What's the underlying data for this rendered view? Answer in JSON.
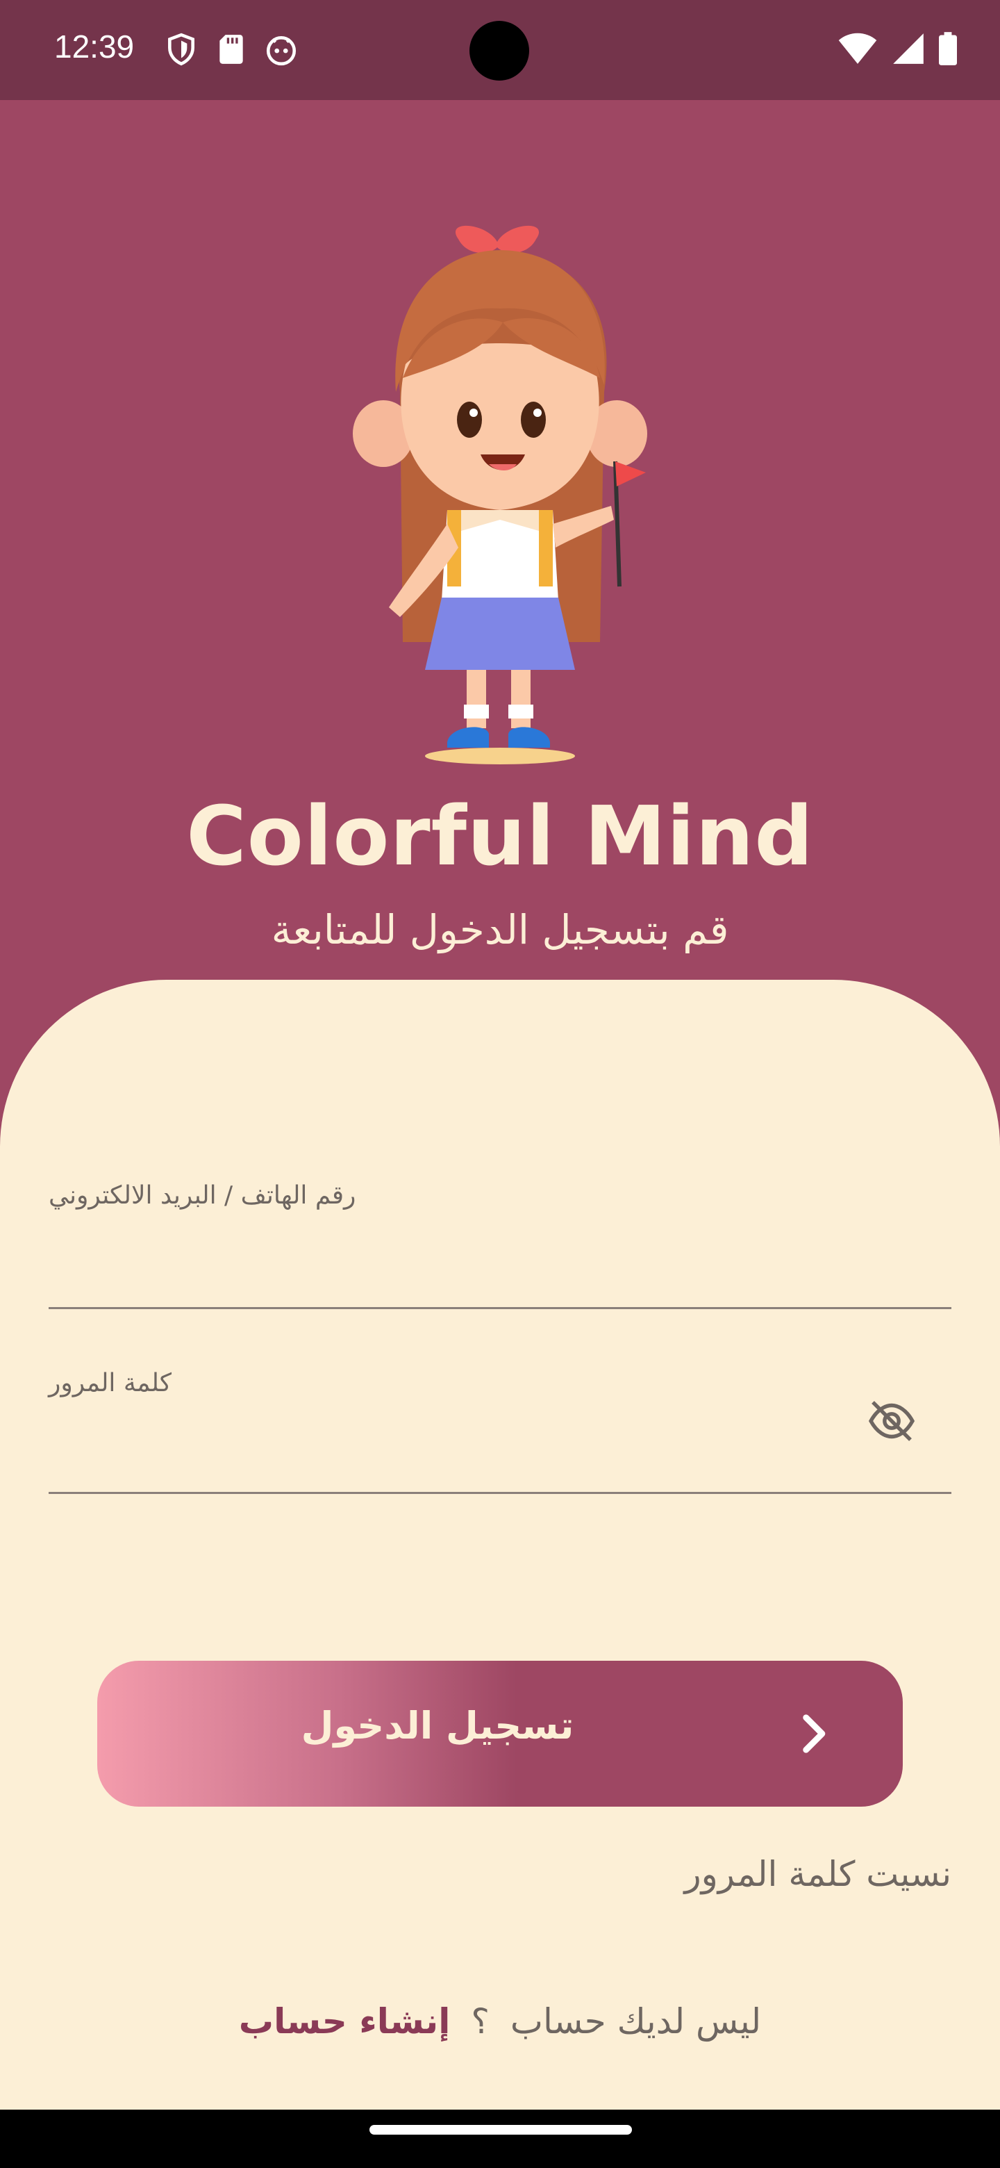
{
  "status_bar": {
    "time": "12:39",
    "left_icons": [
      "shield-icon",
      "sd-card-icon",
      "android-face-icon"
    ],
    "right_icons": [
      "wifi-icon",
      "signal-icon",
      "battery-icon"
    ]
  },
  "header": {
    "app_title": "Colorful Mind",
    "subtitle": "قم بتسجيل الدخول للمتابعة",
    "mascot": "girl-with-flag-illustration"
  },
  "form": {
    "identifier_label": "رقم الهاتف / البريد الالكتروني",
    "identifier_value": "",
    "password_label": "كلمة المرور",
    "password_value": "",
    "password_toggle_icon": "eye-off-icon"
  },
  "login_button": {
    "label": "تسجيل الدخول",
    "icon": "chevron-right-icon"
  },
  "forgot_password": "نسيت كلمة المرور",
  "signup": {
    "prompt": "ليس لديك حساب",
    "question_mark": "؟",
    "link": "إنشاء حساب"
  },
  "colors": {
    "primary": "#9e4763",
    "status_bar": "#74344b",
    "card_background": "#fcefd6",
    "title_text": "#fcefd6",
    "gradient_start": "#f49cac",
    "link_accent": "#8a3a56"
  }
}
